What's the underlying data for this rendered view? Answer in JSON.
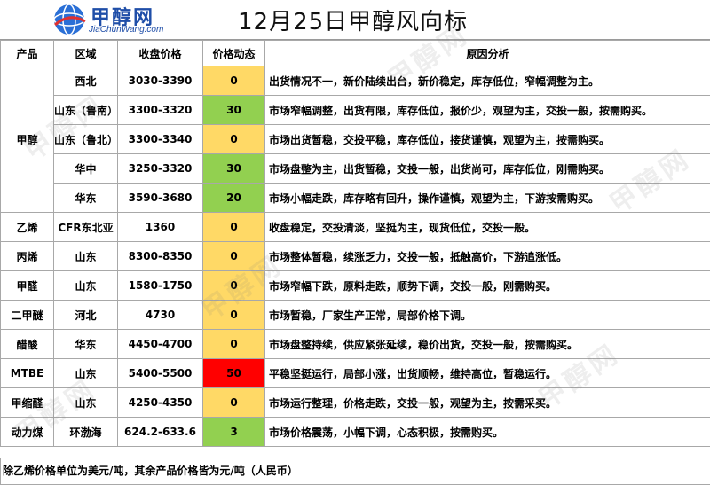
{
  "header": {
    "logo_cn": "甲醇网",
    "logo_url": "JiaChunWang.com",
    "title": "12月25日甲醇风向标"
  },
  "table": {
    "columns": [
      "产品",
      "区域",
      "收盘价格",
      "价格动态",
      "原因分析"
    ],
    "rows": [
      {
        "product": "甲醇",
        "region": "西北",
        "price": "3030-3390",
        "dynamic": "0",
        "dyn_color": "#ffd966",
        "analysis": "出货情况不一，新价陆续出台，新价稳定，库存低位，窄幅调整为主。"
      },
      {
        "product": "",
        "region": "山东（鲁南）",
        "price": "3300-3320",
        "dynamic": "30",
        "dyn_color": "#92d050",
        "analysis": "市场窄幅调整，出货有限，库存低位，报价少，观望为主，交投一般，按需购买。"
      },
      {
        "product": "",
        "region": "山东（鲁北）",
        "price": "3300-3340",
        "dynamic": "0",
        "dyn_color": "#ffd966",
        "analysis": "市场出货暂稳，交投平稳，库存低位，接货谨慎，观望为主，按需购买。"
      },
      {
        "product": "",
        "region": "华中",
        "price": "3250-3320",
        "dynamic": "30",
        "dyn_color": "#92d050",
        "analysis": "市场盘整为主，出货暂稳，交投一般，出货尚可，库存低位，刚需购买。"
      },
      {
        "product": "",
        "region": "华东",
        "price": "3590-3680",
        "dynamic": "20",
        "dyn_color": "#92d050",
        "analysis": "市场小幅走跌，库存略有回升，操作谨慎，观望为主，下游按需购买。"
      },
      {
        "product": "乙烯",
        "region": "CFR东北亚",
        "price": "1360",
        "dynamic": "0",
        "dyn_color": "#ffd966",
        "analysis": "收盘稳定，交投清淡，坚挺为主，现货低位，交投一般。"
      },
      {
        "product": "丙烯",
        "region": "山东",
        "price": "8300-8350",
        "dynamic": "0",
        "dyn_color": "#ffd966",
        "analysis": "市场整体暂稳，续涨乏力，交投一般，抵触高价，下游追涨低。"
      },
      {
        "product": "甲醛",
        "region": "山东",
        "price": "1580-1750",
        "dynamic": "0",
        "dyn_color": "#ffd966",
        "analysis": "市场窄幅下跌，原料走跌，顺势下调，交投一般，刚需购买。"
      },
      {
        "product": "二甲醚",
        "region": "河北",
        "price": "4730",
        "dynamic": "0",
        "dyn_color": "#ffd966",
        "analysis": "市场暂稳，厂家生产正常，局部价格下调。"
      },
      {
        "product": "醋酸",
        "region": "华东",
        "price": "4450-4700",
        "dynamic": "0",
        "dyn_color": "#ffd966",
        "analysis": "市场盘整持续，供应紧张延续，稳价出货，交投一般，按需购买。"
      },
      {
        "product": "MTBE",
        "region": "山东",
        "price": "5400-5500",
        "dynamic": "50",
        "dyn_color": "#ff0000",
        "analysis": "平稳坚挺运行，局部小涨，出货顺畅，维持高位，暂稳运行。"
      },
      {
        "product": "甲缩醛",
        "region": "山东",
        "price": "4250-4350",
        "dynamic": "0",
        "dyn_color": "#ffd966",
        "analysis": "市场运行整理，价格走跌，交投一般，观望为主，按需采买。"
      },
      {
        "product": "动力煤",
        "region": "环渤海",
        "price": "624.2-633.6",
        "dynamic": "3",
        "dyn_color": "#92d050",
        "analysis": "市场价格震荡，小幅下调，心态积极，按需购买。"
      }
    ]
  },
  "footer": {
    "note": "除乙烯价格单位为美元/吨，其余产品价格皆为元/吨（人民币）"
  }
}
